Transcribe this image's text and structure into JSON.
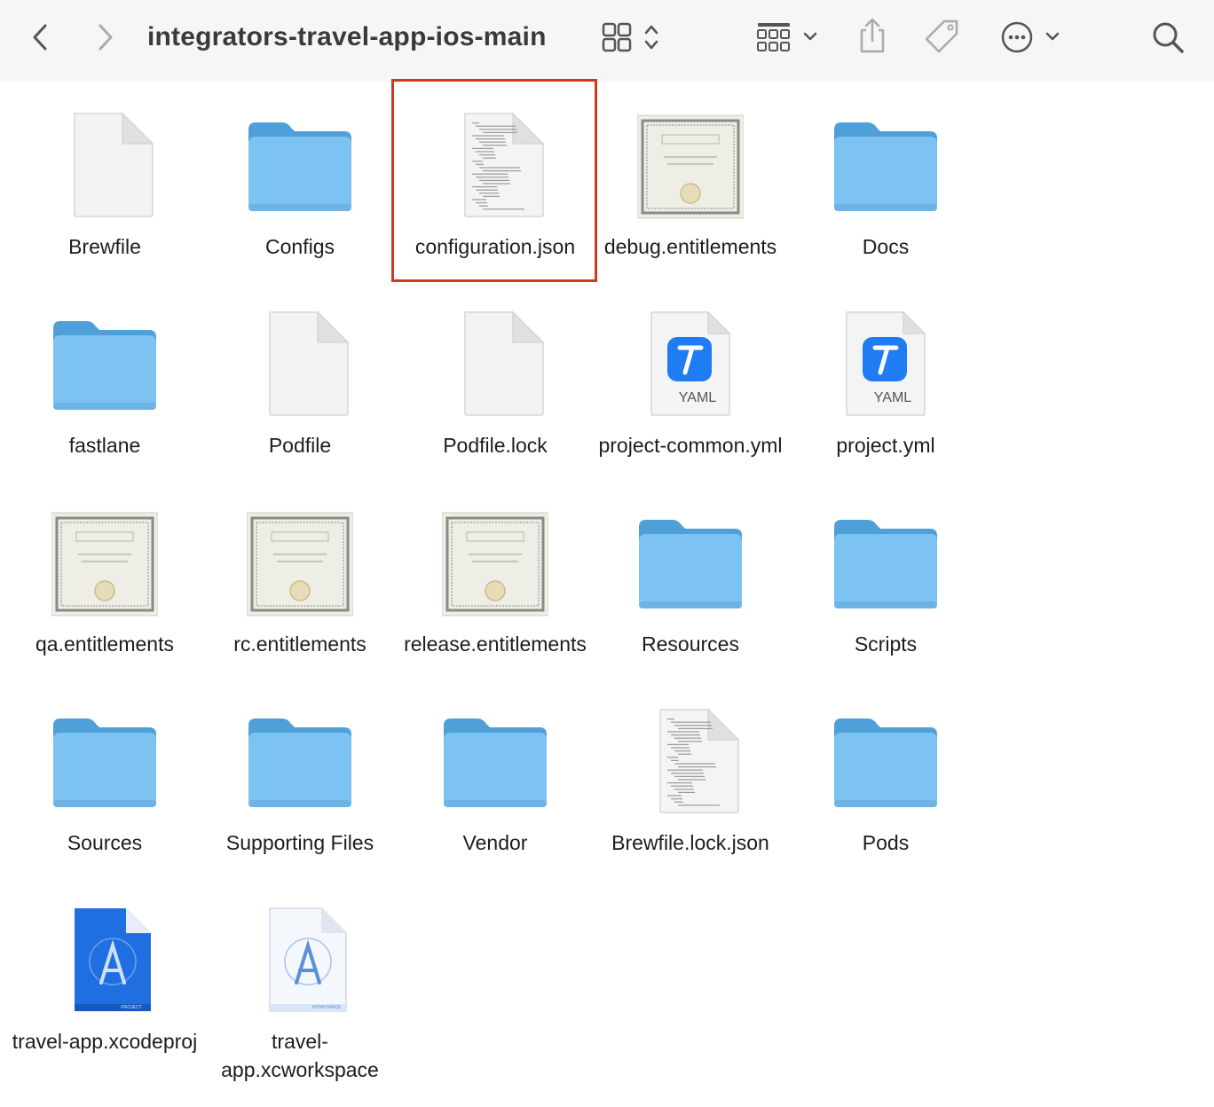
{
  "window": {
    "title": "integrators-travel-app-ios-main"
  },
  "toolbar": {
    "back_icon": "chevron-left-icon",
    "forward_icon": "chevron-right-icon",
    "view_icon": "grid-view-icon",
    "group_icon": "group-icon",
    "share_icon": "share-icon",
    "tag_icon": "tag-icon",
    "more_icon": "ellipsis-circle-icon",
    "search_icon": "search-icon"
  },
  "colors": {
    "folder": "#7cc3f2",
    "highlight": "#cc3a22",
    "xcode_blue": "#1f6fe0"
  },
  "files": [
    {
      "name": "Brewfile",
      "type": "document"
    },
    {
      "name": "Configs",
      "type": "folder"
    },
    {
      "name": "configuration.json",
      "type": "json",
      "selected": true
    },
    {
      "name": "debug.entitlements",
      "type": "entitlements"
    },
    {
      "name": "Docs",
      "type": "folder"
    },
    {
      "name": "fastlane",
      "type": "folder"
    },
    {
      "name": "Podfile",
      "type": "document"
    },
    {
      "name": "Podfile.lock",
      "type": "document"
    },
    {
      "name": "project-common.yml",
      "type": "yaml",
      "badge": "YAML"
    },
    {
      "name": "project.yml",
      "type": "yaml",
      "badge": "YAML"
    },
    {
      "name": "qa.entitlements",
      "type": "entitlements"
    },
    {
      "name": "rc.entitlements",
      "type": "entitlements"
    },
    {
      "name": "release.entitlements",
      "type": "entitlements"
    },
    {
      "name": "Resources",
      "type": "folder"
    },
    {
      "name": "Scripts",
      "type": "folder"
    },
    {
      "name": "Sources",
      "type": "folder"
    },
    {
      "name": "Supporting Files",
      "type": "folder"
    },
    {
      "name": "Vendor",
      "type": "folder"
    },
    {
      "name": "Brewfile.lock.json",
      "type": "json"
    },
    {
      "name": "Pods",
      "type": "folder"
    },
    {
      "name": "travel-app.xcodeproj",
      "type": "xcodeproj",
      "badge": "PROJECT"
    },
    {
      "name": "travel-app.xcworkspace",
      "type": "xcworkspace",
      "badge": "WORKSPACE"
    }
  ]
}
